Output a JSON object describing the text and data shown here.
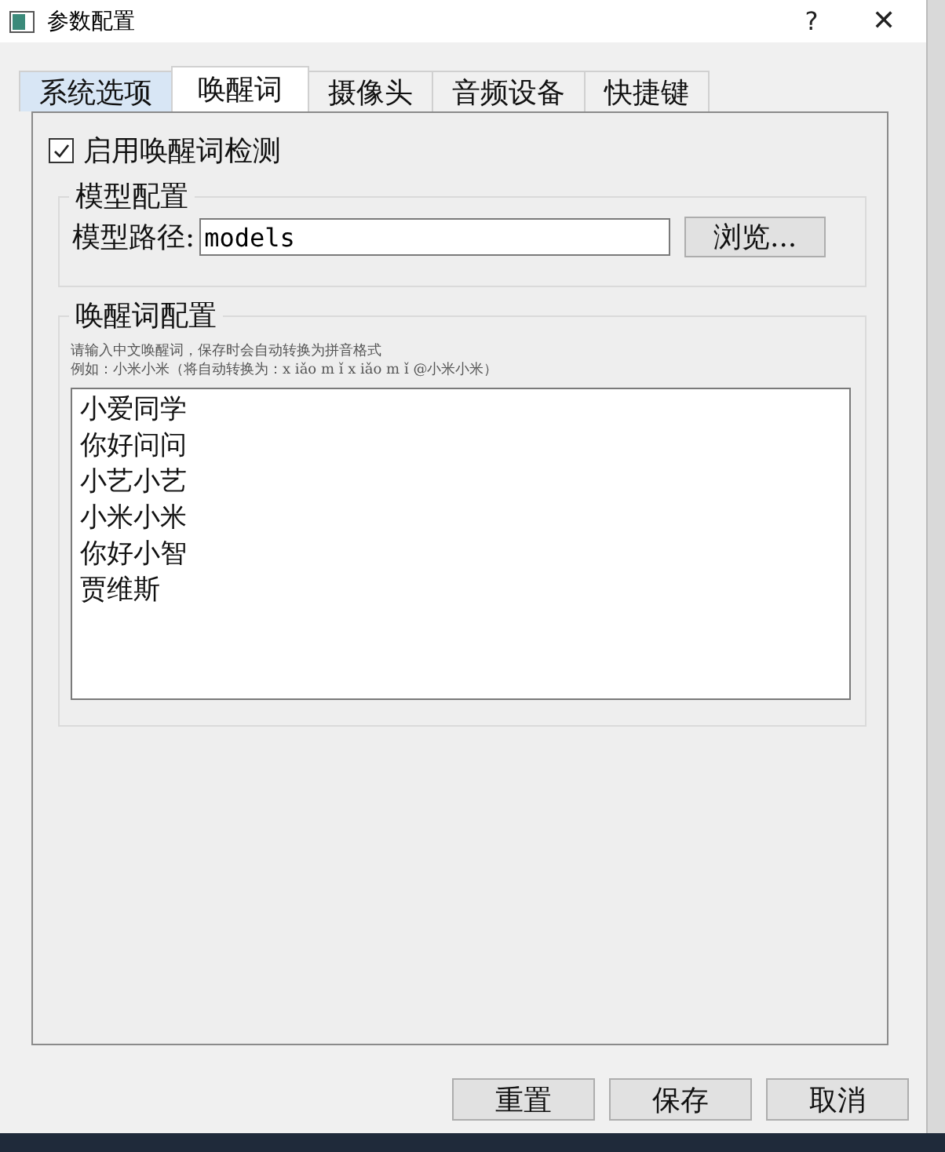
{
  "window": {
    "title": "参数配置",
    "help": "?",
    "close": "✕"
  },
  "tabs": [
    {
      "label": "系统选项",
      "selected": false,
      "hovered": true
    },
    {
      "label": "唤醒词",
      "selected": true,
      "hovered": false
    },
    {
      "label": "摄像头",
      "selected": false,
      "hovered": false
    },
    {
      "label": "音频设备",
      "selected": false,
      "hovered": false
    },
    {
      "label": "快捷键",
      "selected": false,
      "hovered": false
    }
  ],
  "enable_checkbox": {
    "label": "启用唤醒词检测",
    "checked": true
  },
  "model_group": {
    "title": "模型配置",
    "path_label": "模型路径:",
    "path_value": "models",
    "browse": "浏览..."
  },
  "wake_group": {
    "title": "唤醒词配置",
    "hint_lines": [
      "请输入中文唤醒词，保存时会自动转换为拼音格式",
      "例如：小米小米（将自动转换为：x iǎo m ǐ x iǎo m ǐ @小米小米）"
    ],
    "words": [
      "小爱同学",
      "你好问问",
      "小艺小艺",
      "小米小米",
      "你好小智",
      "贾维斯"
    ]
  },
  "buttons": [
    "重置",
    "保存",
    "取消"
  ]
}
